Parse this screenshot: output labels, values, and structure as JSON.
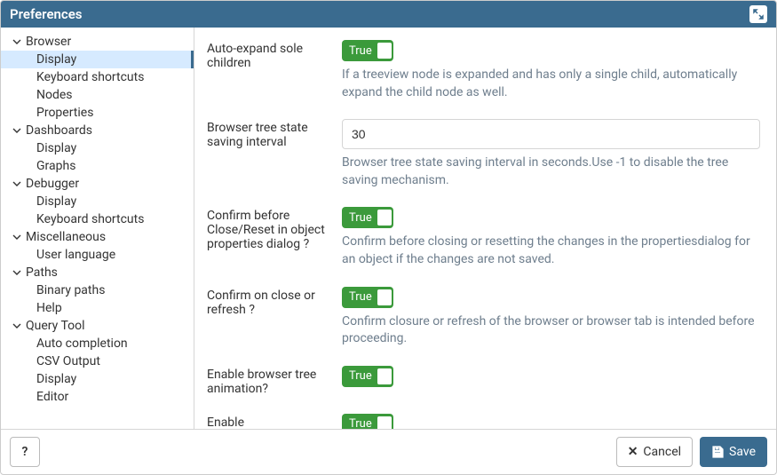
{
  "header": {
    "title": "Preferences"
  },
  "sidebar": {
    "groups": [
      {
        "label": "Browser",
        "items": [
          "Display",
          "Keyboard shortcuts",
          "Nodes",
          "Properties"
        ]
      },
      {
        "label": "Dashboards",
        "items": [
          "Display",
          "Graphs"
        ]
      },
      {
        "label": "Debugger",
        "items": [
          "Display",
          "Keyboard shortcuts"
        ]
      },
      {
        "label": "Miscellaneous",
        "items": [
          "User language"
        ]
      },
      {
        "label": "Paths",
        "items": [
          "Binary paths",
          "Help"
        ]
      },
      {
        "label": "Query Tool",
        "items": [
          "Auto completion",
          "CSV Output",
          "Display",
          "Editor"
        ]
      }
    ],
    "selected_group": 0,
    "selected_item": 0
  },
  "settings": [
    {
      "label": "Auto-expand sole children",
      "type": "toggle",
      "value_label": "True",
      "help": "If a treeview node is expanded and has only a single child, automatically expand the child node as well."
    },
    {
      "label": "Browser tree state saving interval",
      "type": "text",
      "value": "30",
      "help": "Browser tree state saving interval in seconds.Use -1 to disable the tree saving mechanism."
    },
    {
      "label": "Confirm before Close/Reset in object properties dialog ?",
      "type": "toggle",
      "value_label": "True",
      "help": "Confirm before closing or resetting the changes in the propertiesdialog for an object if the changes are not saved."
    },
    {
      "label": "Confirm on close or refresh ?",
      "type": "toggle",
      "value_label": "True",
      "help": "Confirm closure or refresh of the browser or browser tab is intended before proceeding."
    },
    {
      "label": "Enable browser tree animation?",
      "type": "toggle",
      "value_label": "True",
      "help": ""
    },
    {
      "label": "Enable dialogue/notification animation?",
      "type": "toggle",
      "value_label": "True",
      "help": ""
    }
  ],
  "footer": {
    "help_label": "?",
    "cancel_label": "Cancel",
    "save_label": "Save"
  }
}
